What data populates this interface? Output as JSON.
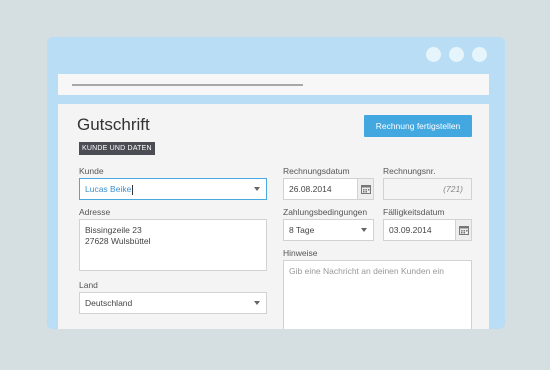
{
  "window": {
    "dots": 3
  },
  "page": {
    "title": "Gutschrift",
    "section_tag": "KUNDE UND DATEN",
    "primary_button": "Rechnung fertigstellen"
  },
  "form": {
    "kunde": {
      "label": "Kunde",
      "value": "Lucas Beike"
    },
    "adresse": {
      "label": "Adresse",
      "line1": "Bissingzeile 23",
      "line2": "27628 Wulsbüttel"
    },
    "land": {
      "label": "Land",
      "value": "Deutschland"
    },
    "rechnungsdatum": {
      "label": "Rechnungsdatum",
      "value": "26.08.2014"
    },
    "rechnungsnr": {
      "label": "Rechnungsnr.",
      "value": "(721)"
    },
    "zahlungsbedingungen": {
      "label": "Zahlungsbedingungen",
      "value": "8 Tage"
    },
    "faelligkeitsdatum": {
      "label": "Fälligkeitsdatum",
      "value": "03.09.2014"
    },
    "hinweise": {
      "label": "Hinweise",
      "placeholder": "Gib eine Nachricht an deinen Kunden ein"
    }
  },
  "icons": {
    "calendar": "calendar-icon",
    "dropdown": "chevron-down-icon"
  }
}
